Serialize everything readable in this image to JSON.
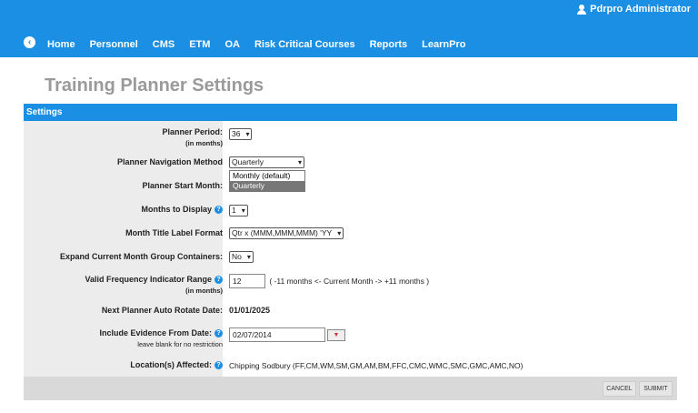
{
  "header": {
    "user_name": "Pdrpro Administrator",
    "nav": [
      "Home",
      "Personnel",
      "CMS",
      "ETM",
      "OA",
      "Risk Critical Courses",
      "Reports",
      "LearnPro"
    ]
  },
  "page": {
    "title": "Training Planner Settings"
  },
  "panel": {
    "title": "Settings"
  },
  "fields": {
    "planner_period": {
      "label": "Planner Period:",
      "sub": "(in months)",
      "value": "36"
    },
    "nav_method": {
      "label": "Planner Navigation Method",
      "value": "Quarterly",
      "options": [
        "Monthly (default)",
        "Quarterly"
      ]
    },
    "start_month": {
      "label": "Planner Start Month:"
    },
    "months_display": {
      "label": "Months to Display",
      "value": "1"
    },
    "month_title": {
      "label": "Month Title Label Format",
      "value": "Qtr x (MMM,MMM,MMM) 'YY"
    },
    "expand_groups": {
      "label": "Expand Current Month Group Containers:",
      "value": "No"
    },
    "valid_freq": {
      "label": "Valid Frequency Indicator Range",
      "sub": "(in months)",
      "value": "12",
      "hint": "( -11 months <- Current Month -> +11 months )"
    },
    "next_rotate": {
      "label": "Next Planner Auto Rotate Date:",
      "value": "01/01/2025"
    },
    "evidence_from": {
      "label": "Include Evidence From Date:",
      "sub": "leave blank for no restriction",
      "value": "02/07/2014"
    },
    "locations": {
      "label": "Location(s) Affected:",
      "value": "Chipping Sodbury (FF,CM,WM,SM,GM,AM,BM,FFC,CMC,WMC,SMC,GMC,AMC,NO)"
    }
  },
  "buttons": {
    "cancel": "CANCEL",
    "submit": "SUBMIT"
  }
}
